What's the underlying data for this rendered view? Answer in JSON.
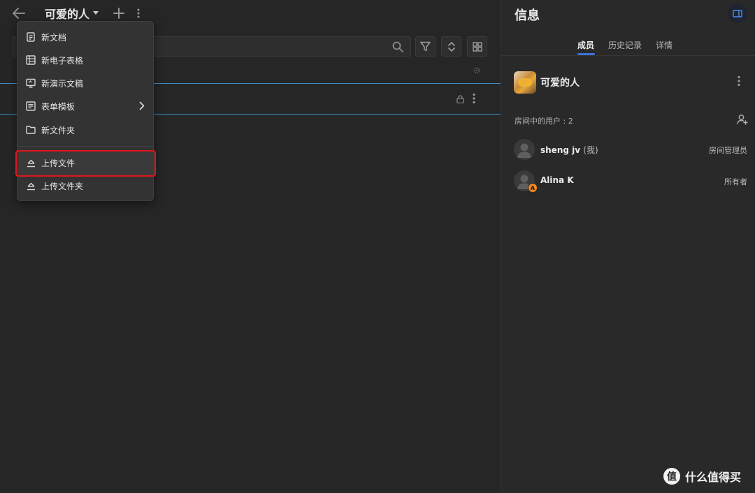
{
  "header": {
    "title": "可爱的人"
  },
  "menu": {
    "items": [
      {
        "label": "新文档",
        "icon": "document-icon"
      },
      {
        "label": "新电子表格",
        "icon": "spreadsheet-icon"
      },
      {
        "label": "新演示文稿",
        "icon": "presentation-icon"
      },
      {
        "label": "表单模板",
        "icon": "form-template-icon",
        "submenu": true
      },
      {
        "label": "新文件夹",
        "icon": "folder-icon"
      },
      {
        "label": "上传文件",
        "icon": "upload-icon",
        "highlighted": true
      },
      {
        "label": "上传文件夹",
        "icon": "upload-folder-icon"
      }
    ]
  },
  "panel": {
    "title": "信息",
    "tabs": [
      {
        "label": "成员",
        "active": true
      },
      {
        "label": "历史记录",
        "active": false
      },
      {
        "label": "详情",
        "active": false
      }
    ],
    "room_name": "可爱的人",
    "users_label": "房间中的用户 : 2",
    "users": [
      {
        "name": "sheng jv",
        "suffix": "(我)",
        "role": "房间管理员",
        "badge": ""
      },
      {
        "name": "Alina K",
        "suffix": "",
        "role": "所有者",
        "badge": "A"
      }
    ]
  },
  "watermark": {
    "logo": "值",
    "text": "什么值得买"
  },
  "colors": {
    "background": "#262626",
    "panel": "#292929",
    "menu": "#333333",
    "accent": "#3b72d8",
    "highlight_border": "#e0141e",
    "badge": "#f08a1c"
  }
}
